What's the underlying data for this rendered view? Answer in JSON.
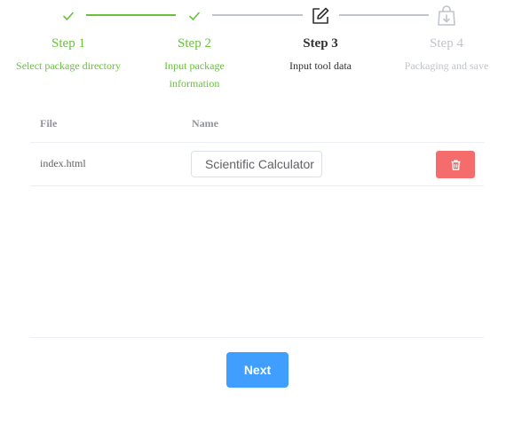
{
  "steps": [
    {
      "title": "Step 1",
      "description": "Select package directory",
      "status": "finish",
      "icon": "check-icon"
    },
    {
      "title": "Step 2",
      "description": "Input package information",
      "status": "finish",
      "icon": "check-icon"
    },
    {
      "title": "Step 3",
      "description": "Input tool data",
      "status": "process",
      "icon": "edit-icon"
    },
    {
      "title": "Step 4",
      "description": "Packaging and save",
      "status": "wait",
      "icon": "shopping-bag-icon"
    }
  ],
  "table": {
    "columns": {
      "file": "File",
      "name": "Name"
    },
    "rows": [
      {
        "file": "index.html",
        "name": "Scientific Calculator",
        "action_icon": "trash-icon"
      }
    ]
  },
  "actions": {
    "next_label": "Next"
  },
  "colors": {
    "finish": "#67c23a",
    "process": "#303133",
    "wait": "#c0c4cc",
    "primary": "#409eff",
    "danger": "#f56c6c"
  }
}
